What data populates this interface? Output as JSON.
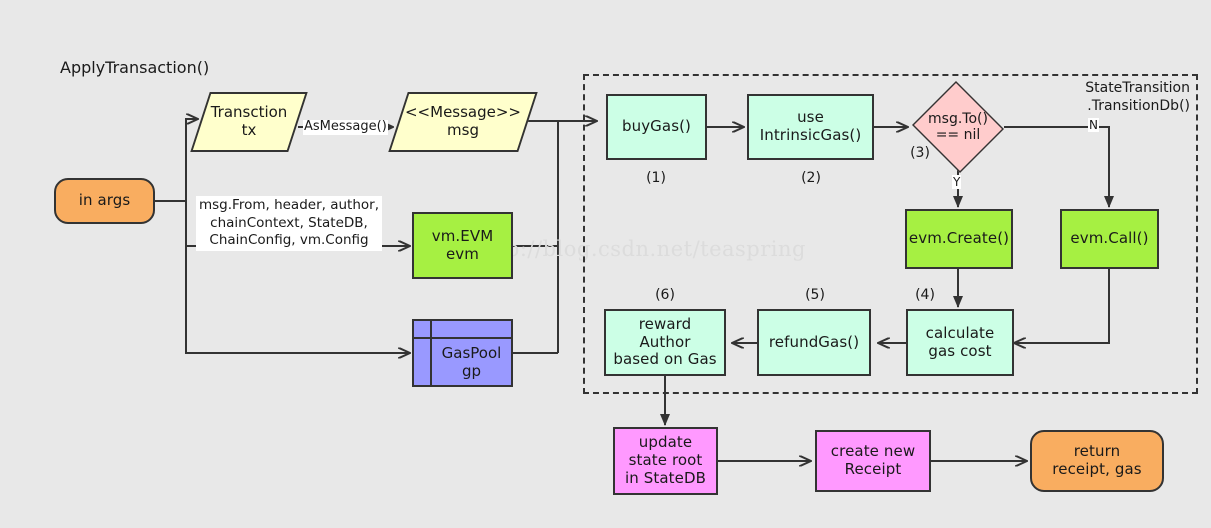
{
  "diagram": {
    "title": "ApplyTransaction()",
    "watermark": "http://blog.csdn.net/teaspring",
    "background_color": "#e8e8e8",
    "stroke_color": "#333333"
  },
  "region": {
    "label": "StateTransition\n.TransitionDb()",
    "style": "dashed"
  },
  "nodes": {
    "in_args": {
      "label": "in args",
      "shape": "terminal",
      "color": "#f9ad60"
    },
    "transaction": {
      "label": "Transction\ntx",
      "shape": "parallelogram",
      "color": "#ffffcc"
    },
    "message": {
      "label": "<<Message>>\nmsg",
      "shape": "parallelogram",
      "color": "#ffffcc"
    },
    "evm": {
      "label": "vm.EVM\nevm",
      "shape": "rect",
      "color": "#a6f042"
    },
    "gaspool": {
      "label": "GasPool\ngp",
      "shape": "object",
      "color": "#9999ff"
    },
    "buy_gas": {
      "label": "buyGas()",
      "shape": "rect",
      "color": "#ccffe6"
    },
    "use_intrinsic_gas": {
      "label": "use\nIntrinsicGas()",
      "shape": "rect",
      "color": "#ccffe6"
    },
    "msg_to_nil": {
      "label": "msg.To()\n== nil",
      "shape": "diamond",
      "color": "#ffcccc"
    },
    "evm_create": {
      "label": "evm.Create()",
      "shape": "rect",
      "color": "#a6f042"
    },
    "evm_call": {
      "label": "evm.Call()",
      "shape": "rect",
      "color": "#a6f042"
    },
    "calculate_gas_cost": {
      "label": "calculate\ngas cost",
      "shape": "rect",
      "color": "#ccffe6"
    },
    "refund_gas": {
      "label": "refundGas()",
      "shape": "rect",
      "color": "#ccffe6"
    },
    "reward_author": {
      "label": "reward\nAuthor\nbased on Gas",
      "shape": "rect",
      "color": "#ccffe6"
    },
    "update_state_root": {
      "label": "update\nstate root\nin StateDB",
      "shape": "rect",
      "color": "#ff99ff"
    },
    "create_receipt": {
      "label": "create new\nReceipt",
      "shape": "rect",
      "color": "#ff99ff"
    },
    "return_receipt": {
      "label": "return\nreceipt, gas",
      "shape": "terminal",
      "color": "#f9ad60"
    }
  },
  "step_numbers": {
    "buy_gas": "(1)",
    "use_intrinsic_gas": "(2)",
    "msg_to_nil": "(3)",
    "calculate_gas_cost": "(4)",
    "refund_gas": "(5)",
    "reward_author": "(6)"
  },
  "edge_labels": {
    "as_message": "AsMessage()",
    "args_list": "msg.From, header, author,\nchainContext, StateDB,\nChainConfig, vm.Config",
    "branch_yes": "Y",
    "branch_no": "N"
  }
}
